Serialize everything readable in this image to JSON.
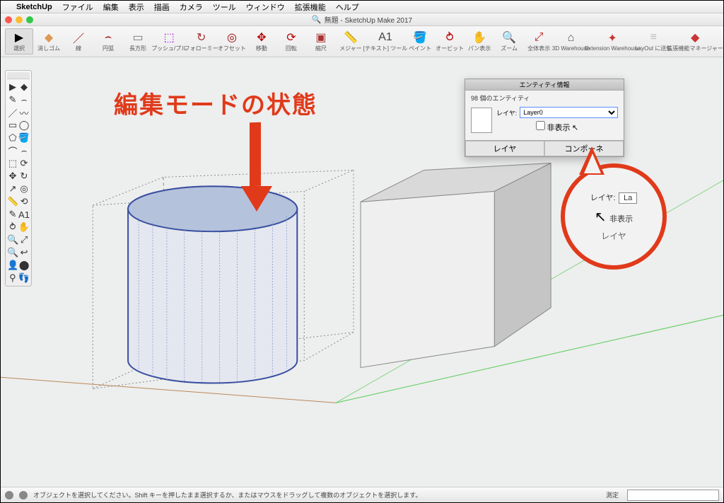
{
  "menubar": {
    "app": "SketchUp",
    "items": [
      "ファイル",
      "編集",
      "表示",
      "描画",
      "カメラ",
      "ツール",
      "ウィンドウ",
      "拡張機能",
      "ヘルプ"
    ]
  },
  "window": {
    "title": "無題 - SketchUp Make 2017"
  },
  "toolbar": {
    "items": [
      {
        "name": "select",
        "label": "選択",
        "glyph": "▶",
        "color": "#000",
        "selected": true
      },
      {
        "name": "eraser",
        "label": "消しゴム",
        "glyph": "◆",
        "color": "#d95"
      },
      {
        "name": "line",
        "label": "線",
        "glyph": "／",
        "color": "#900"
      },
      {
        "name": "arc",
        "label": "円弧",
        "glyph": "⌢",
        "color": "#900"
      },
      {
        "name": "rect",
        "label": "長方形",
        "glyph": "▭",
        "color": "#777"
      },
      {
        "name": "pushpull",
        "label": "プッシュ/プル",
        "glyph": "⬚",
        "color": "#a0d"
      },
      {
        "name": "followme",
        "label": "フォローミー",
        "glyph": "↻",
        "color": "#a33"
      },
      {
        "name": "offset",
        "label": "オフセット",
        "glyph": "◎",
        "color": "#900"
      },
      {
        "name": "move",
        "label": "移動",
        "glyph": "✥",
        "color": "#b00"
      },
      {
        "name": "rotate",
        "label": "回転",
        "glyph": "⟳",
        "color": "#b00"
      },
      {
        "name": "scale",
        "label": "縮尺",
        "glyph": "▣",
        "color": "#a33"
      },
      {
        "name": "tape",
        "label": "メジャー",
        "glyph": "📏",
        "color": "#777"
      },
      {
        "name": "text",
        "label": "[テキスト] ツール",
        "glyph": "A1",
        "color": "#444"
      },
      {
        "name": "paint",
        "label": "ペイント",
        "glyph": "🪣",
        "color": "#a33"
      },
      {
        "name": "orbit",
        "label": "オービット",
        "glyph": "⥁",
        "color": "#b00"
      },
      {
        "name": "pan",
        "label": "パン表示",
        "glyph": "✋",
        "color": "#b00"
      },
      {
        "name": "zoom",
        "label": "ズーム",
        "glyph": "🔍",
        "color": "#444"
      },
      {
        "name": "zoomext",
        "label": "全体表示",
        "glyph": "⤢",
        "color": "#b22"
      },
      {
        "name": "3dw",
        "label": "3D Warehouse",
        "glyph": "⌂",
        "color": "#555"
      },
      {
        "name": "ext",
        "label": "Extension Warehouse",
        "glyph": "✦",
        "color": "#c33"
      },
      {
        "name": "layout",
        "label": "LayOut に送信",
        "glyph": "≡",
        "color": "#bbb"
      },
      {
        "name": "extmgr",
        "label": "拡張機能マネージャー",
        "glyph": "◆",
        "color": "#c33"
      }
    ]
  },
  "palette": {
    "rows": [
      [
        "▶",
        "◆"
      ],
      [
        "✎",
        "⌢"
      ],
      [
        "／",
        "〰"
      ],
      [
        "▭",
        "◯"
      ],
      [
        "⬠",
        "🪣"
      ],
      [
        "⌒",
        "⌢"
      ],
      [
        "⬚",
        "⟳"
      ],
      [
        "✥",
        "↻"
      ],
      [
        "↗",
        "◎"
      ],
      [
        "📏",
        "⟲"
      ],
      [
        "✎",
        "A1"
      ],
      [
        "⥁",
        "✋"
      ],
      [
        "🔍",
        "⤢"
      ],
      [
        "🔍",
        "↩"
      ],
      [
        "👤",
        "⬤"
      ],
      [
        "⚲",
        "👣"
      ]
    ]
  },
  "panel": {
    "title": "エンティティ情報",
    "count": "98 個のエンティティ",
    "layer_label": "レイヤ:",
    "layer_value": "Layer0",
    "hide_label": "非表示",
    "tabs": [
      "レイヤ",
      "コンポーネ"
    ]
  },
  "bubble": {
    "layer": "レイヤ:",
    "layer_val": "La",
    "hide": "非表示",
    "bottom": "レイヤ"
  },
  "annotation": "編集モードの状態",
  "statusbar": {
    "tip": "オブジェクトを選択してください。Shift キーを押したまま選択するか、またはマウスをドラッグして複数のオブジェクトを選択します。",
    "measure_label": "測定"
  }
}
